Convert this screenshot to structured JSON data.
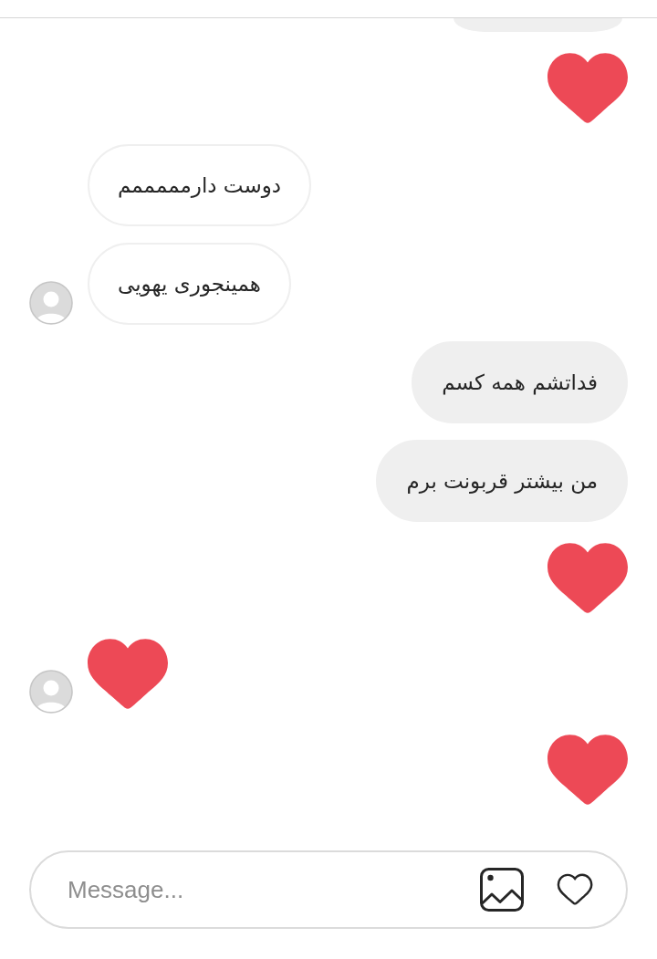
{
  "messages": [
    {
      "outgoing": true,
      "kind": "clipped"
    },
    {
      "outgoing": true,
      "kind": "heart"
    },
    {
      "outgoing": false,
      "kind": "text",
      "text": "دوست دارمممممم",
      "show_avatar": false
    },
    {
      "outgoing": false,
      "kind": "text",
      "text": "همینجوری یهویی",
      "show_avatar": true
    },
    {
      "outgoing": true,
      "kind": "text",
      "text": "فداتشم همه کسم"
    },
    {
      "outgoing": true,
      "kind": "text",
      "text": "من بیشتر قربونت برم"
    },
    {
      "outgoing": true,
      "kind": "heart"
    },
    {
      "outgoing": false,
      "kind": "heart",
      "show_avatar": true
    },
    {
      "outgoing": true,
      "kind": "heart"
    }
  ],
  "composer": {
    "placeholder": "Message..."
  }
}
